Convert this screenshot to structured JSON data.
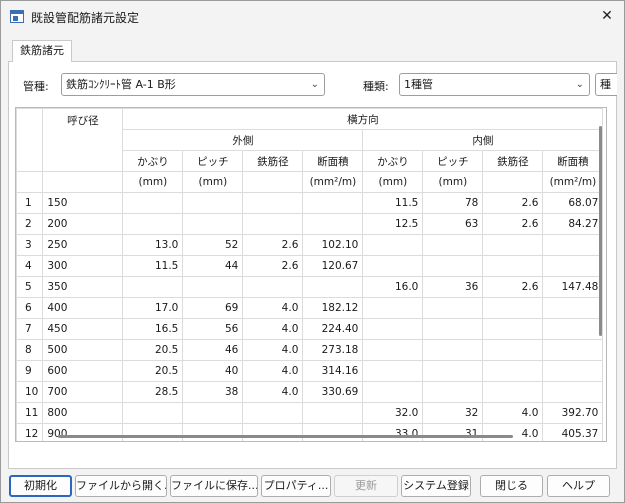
{
  "window": {
    "title": "既設管配筋諸元設定",
    "close": "✕"
  },
  "tab": {
    "label": "鉄筋諸元"
  },
  "filters": {
    "kanshu_label": "管種:",
    "kanshu_value": "鉄筋ｺﾝｸﾘｰﾄ管 A-1 B形",
    "shurui_label": "種類:",
    "shurui_value": "1種管",
    "extra_value": "種"
  },
  "grid": {
    "header": {
      "yobi": "呼び径",
      "yokohoko": "横方向",
      "sotogawa": "外側",
      "uchigawa": "内側",
      "cols": [
        "かぶり",
        "ピッチ",
        "鉄筋径",
        "断面積",
        "かぶり",
        "ピッチ",
        "鉄筋径",
        "断面積"
      ],
      "units": [
        "(mm)",
        "(mm)",
        "",
        "(mm²/m)",
        "(mm)",
        "(mm)",
        "",
        "(mm²/m)"
      ]
    },
    "rows": [
      {
        "no": "1",
        "d": "150",
        "c": [
          "",
          "",
          "",
          "",
          "11.5",
          "78",
          "2.6",
          "68.07"
        ]
      },
      {
        "no": "2",
        "d": "200",
        "c": [
          "",
          "",
          "",
          "",
          "12.5",
          "63",
          "2.6",
          "84.27"
        ]
      },
      {
        "no": "3",
        "d": "250",
        "c": [
          "13.0",
          "52",
          "2.6",
          "102.10",
          "",
          "",
          "",
          ""
        ]
      },
      {
        "no": "4",
        "d": "300",
        "c": [
          "11.5",
          "44",
          "2.6",
          "120.67",
          "",
          "",
          "",
          ""
        ]
      },
      {
        "no": "5",
        "d": "350",
        "c": [
          "",
          "",
          "",
          "",
          "16.0",
          "36",
          "2.6",
          "147.48"
        ]
      },
      {
        "no": "6",
        "d": "400",
        "c": [
          "17.0",
          "69",
          "4.0",
          "182.12",
          "",
          "",
          "",
          ""
        ]
      },
      {
        "no": "7",
        "d": "450",
        "c": [
          "16.5",
          "56",
          "4.0",
          "224.40",
          "",
          "",
          "",
          ""
        ]
      },
      {
        "no": "8",
        "d": "500",
        "c": [
          "20.5",
          "46",
          "4.0",
          "273.18",
          "",
          "",
          "",
          ""
        ]
      },
      {
        "no": "9",
        "d": "600",
        "c": [
          "20.5",
          "40",
          "4.0",
          "314.16",
          "",
          "",
          "",
          ""
        ]
      },
      {
        "no": "10",
        "d": "700",
        "c": [
          "28.5",
          "38",
          "4.0",
          "330.69",
          "",
          "",
          "",
          ""
        ]
      },
      {
        "no": "11",
        "d": "800",
        "c": [
          "",
          "",
          "",
          "",
          "32.0",
          "32",
          "4.0",
          "392.70"
        ]
      },
      {
        "no": "12",
        "d": "900",
        "c": [
          "",
          "",
          "",
          "",
          "33.0",
          "31",
          "4.0",
          "405.37"
        ]
      }
    ]
  },
  "buttons": {
    "init": "初期化",
    "open": "ファイルから開く...",
    "save": "ファイルに保存...",
    "props": "プロパティ...",
    "update": "更新",
    "sysreg": "システム登録",
    "close": "閉じる",
    "help": "ヘルプ"
  },
  "colors": {
    "accent": "#2b66c2",
    "border": "#c9c9c9"
  }
}
